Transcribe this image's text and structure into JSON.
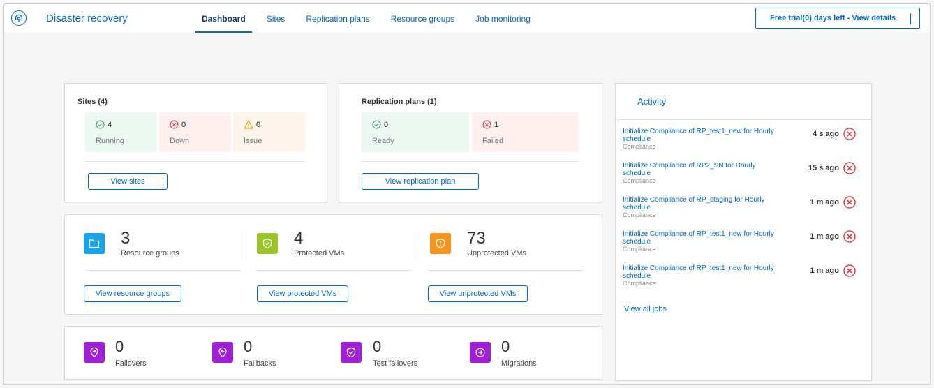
{
  "app": {
    "title": "Disaster recovery"
  },
  "nav": {
    "tabs": [
      {
        "label": "Dashboard",
        "active": true
      },
      {
        "label": "Sites"
      },
      {
        "label": "Replication plans"
      },
      {
        "label": "Resource groups"
      },
      {
        "label": "Job monitoring"
      }
    ]
  },
  "trial": {
    "label": "Free trial(0) days left - View details"
  },
  "sites": {
    "title": "Sites (4)",
    "running": {
      "count": "4",
      "label": "Running"
    },
    "down": {
      "count": "0",
      "label": "Down"
    },
    "issue": {
      "count": "0",
      "label": "Issue"
    },
    "button": "View sites"
  },
  "replication": {
    "title": "Replication plans (1)",
    "ready": {
      "count": "0",
      "label": "Ready"
    },
    "failed": {
      "count": "1",
      "label": "Failed"
    },
    "button": "View replication plan"
  },
  "resources": {
    "groups": {
      "count": "3",
      "label": "Resource groups",
      "button": "View resource groups"
    },
    "protected": {
      "count": "4",
      "label": "Protected VMs",
      "button": "View protected VMs"
    },
    "unprotected": {
      "count": "73",
      "label": "Unprotected VMs",
      "button": "View unprotected VMs"
    }
  },
  "operations": {
    "failovers": {
      "count": "0",
      "label": "Failovers"
    },
    "failbacks": {
      "count": "0",
      "label": "Failbacks"
    },
    "test_failovers": {
      "count": "0",
      "label": "Test failovers"
    },
    "migrations": {
      "count": "0",
      "label": "Migrations"
    }
  },
  "activity": {
    "title": "Activity",
    "items": [
      {
        "text": "Initialize Compliance of RP_test1_new for Hourly schedule",
        "sub": "Compliance",
        "time": "4 s ago"
      },
      {
        "text": "Initialize Compliance of RP2_SN for Hourly schedule",
        "sub": "Compliance",
        "time": "15 s ago"
      },
      {
        "text": "Initialize Compliance of RP_staging for Hourly schedule",
        "sub": "Compliance",
        "time": "1 m ago"
      },
      {
        "text": "Initialize Compliance of RP_test1_new for Hourly schedule",
        "sub": "Compliance",
        "time": "1 m ago"
      },
      {
        "text": "Initialize Compliance of RP_test1_new for Hourly schedule",
        "sub": "Compliance",
        "time": "1 m ago"
      }
    ],
    "view_all": "View all jobs"
  },
  "colors": {
    "accent": "#0067c5",
    "success": "#3a9d5d",
    "error": "#d32f2f",
    "warning": "#e8a000",
    "resource_blue": "#1aa3e8",
    "resource_green": "#9ac32a",
    "resource_orange": "#f59421",
    "operation_purple": "#a020d6"
  }
}
